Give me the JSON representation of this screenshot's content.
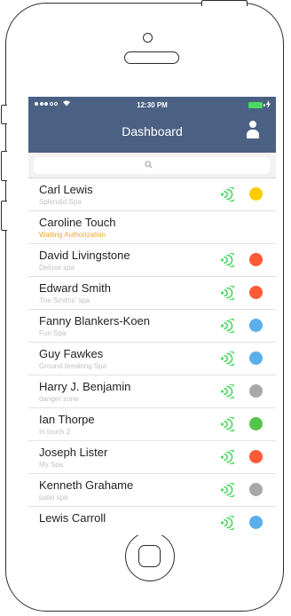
{
  "status_bar": {
    "time": "12:30 PM"
  },
  "header": {
    "title": "Dashboard"
  },
  "search": {
    "placeholder": ""
  },
  "colors": {
    "nav": "#4b6183",
    "signal": "#4cd964",
    "yellow": "#ffcc00",
    "red": "#ff5a36",
    "blue": "#5aaeea",
    "gray": "#a8a8a8",
    "green": "#55c44a",
    "warning_text": "#f5a623"
  },
  "contacts": [
    {
      "name": "Carl Lewis",
      "subtitle": "Splendid Spa",
      "warning": false,
      "connected": true,
      "status_color": "#ffcc00"
    },
    {
      "name": "Caroline Touch",
      "subtitle": "Waiting Authorization",
      "warning": true,
      "connected": false,
      "status_color": ""
    },
    {
      "name": "David Livingstone",
      "subtitle": "Deluxe spa",
      "warning": false,
      "connected": true,
      "status_color": "#ff5a36"
    },
    {
      "name": "Edward Smith",
      "subtitle": "The Smiths' spa",
      "warning": false,
      "connected": true,
      "status_color": "#ff5a36"
    },
    {
      "name": "Fanny Blankers-Koen",
      "subtitle": "Fun Spa",
      "warning": false,
      "connected": true,
      "status_color": "#5aaeea"
    },
    {
      "name": "Guy Fawkes",
      "subtitle": "Ground breaking Spa",
      "warning": false,
      "connected": true,
      "status_color": "#5aaeea"
    },
    {
      "name": "Harry J. Benjamin",
      "subtitle": "danger zone",
      "warning": false,
      "connected": true,
      "status_color": "#a8a8a8"
    },
    {
      "name": "Ian Thorpe",
      "subtitle": "In.touch 2",
      "warning": false,
      "connected": true,
      "status_color": "#55c44a"
    },
    {
      "name": "Joseph Lister",
      "subtitle": "My Spa",
      "warning": false,
      "connected": true,
      "status_color": "#ff5a36"
    },
    {
      "name": "Kenneth Grahame",
      "subtitle": "patio spa",
      "warning": false,
      "connected": true,
      "status_color": "#a8a8a8"
    },
    {
      "name": "Lewis Carroll",
      "subtitle": "",
      "warning": false,
      "connected": true,
      "status_color": "#5aaeea"
    }
  ]
}
